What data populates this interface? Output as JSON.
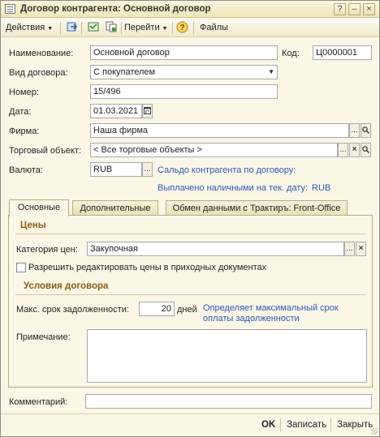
{
  "window": {
    "title": "Договор контрагента: Основной договор"
  },
  "toolbar": {
    "actions": "Действия",
    "goto": "Перейти",
    "files": "Файлы"
  },
  "form": {
    "name_label": "Наименование:",
    "name_value": "Основной договор",
    "code_label": "Код:",
    "code_value": "Ц0000001",
    "type_label": "Вид договора:",
    "type_value": "С покупателем",
    "number_label": "Номер:",
    "number_value": "15/496",
    "date_label": "Дата:",
    "date_value": "01.03.2021",
    "firm_label": "Фирма:",
    "firm_value": "Наша фирма",
    "trade_label": "Торговый объект:",
    "trade_value": "< Все торговые объекты >",
    "currency_label": "Валюта:",
    "currency_value": "RUB",
    "balance_link": "Сальдо контрагента по договору:",
    "paid_text": "Выплачено наличными на тек. дату:",
    "paid_value": "RUB"
  },
  "tabs": [
    "Основные",
    "Дополнительные",
    "Обмен данными с Трактиръ: Front-Office"
  ],
  "tab_main": {
    "prices_section": "Цены",
    "price_cat_label": "Категория цен:",
    "price_cat_value": "Закупочная",
    "allow_edit_label": "Разрешить редактировать цены в приходных документах",
    "allow_edit_checked": false,
    "terms_section": "Условия договора",
    "max_debt_label": "Макс. срок задолженности:",
    "max_debt_value": "20",
    "days_label": "дней",
    "max_debt_hint_1": "Определяет максимальный срок",
    "max_debt_hint_2": "оплаты задолженности",
    "note_label": "Примечание:",
    "note_value": ""
  },
  "comment_label": "Комментарий:",
  "comment_value": "",
  "buttons": {
    "ok": "OK",
    "save": "Записать",
    "close": "Закрыть"
  },
  "colors": {
    "accent_link": "#2d58b7",
    "section_title": "#8a5a17",
    "window_bg": "#fbf7e6"
  }
}
